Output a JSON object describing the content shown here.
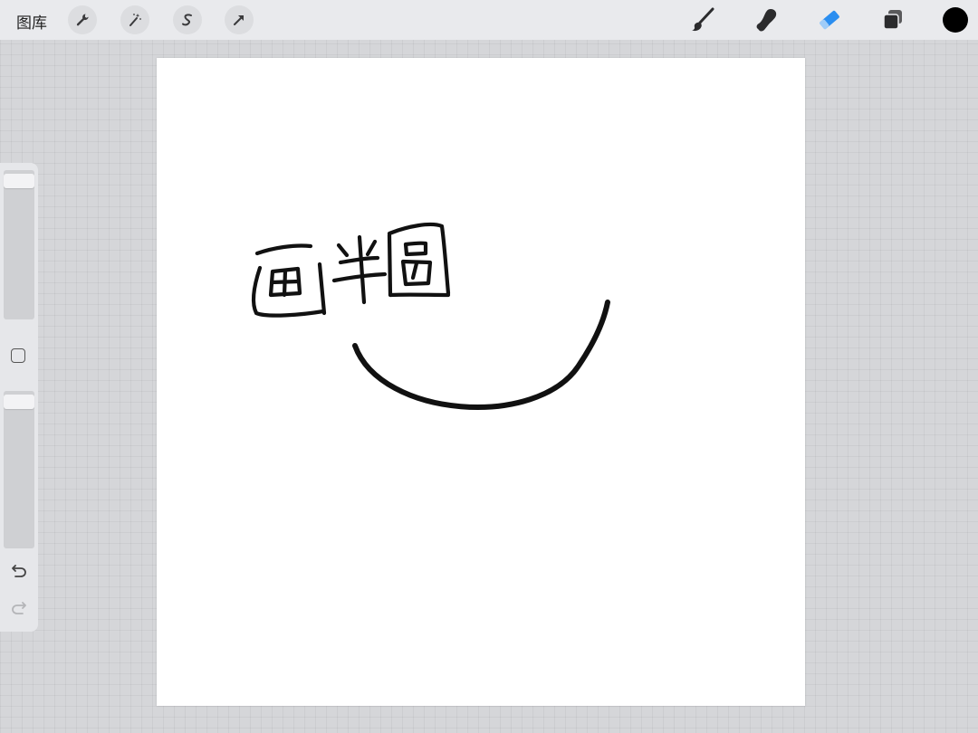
{
  "topbar": {
    "gallery_label": "图库",
    "left_tools": [
      {
        "icon": "wrench-icon",
        "name": "actions"
      },
      {
        "icon": "magic-wand-icon",
        "name": "adjustments"
      },
      {
        "icon": "selection-s-icon",
        "name": "selection"
      },
      {
        "icon": "arrow-cursor-icon",
        "name": "transform"
      }
    ],
    "right_tools": [
      {
        "icon": "brush-icon",
        "name": "paint"
      },
      {
        "icon": "smudge-icon",
        "name": "smudge"
      },
      {
        "icon": "eraser-icon",
        "name": "erase",
        "active": true
      },
      {
        "icon": "layers-icon",
        "name": "layers"
      }
    ],
    "current_color": "#000000",
    "active_color": "#2b8ef0"
  },
  "canvas": {
    "handwritten_text": "画半圆",
    "stroke_color": "#111111"
  },
  "sidebar": {
    "brush_size_level": 1.0,
    "opacity_level": 1.0,
    "icons": [
      "modify-square-icon",
      "undo-icon",
      "redo-icon"
    ]
  }
}
